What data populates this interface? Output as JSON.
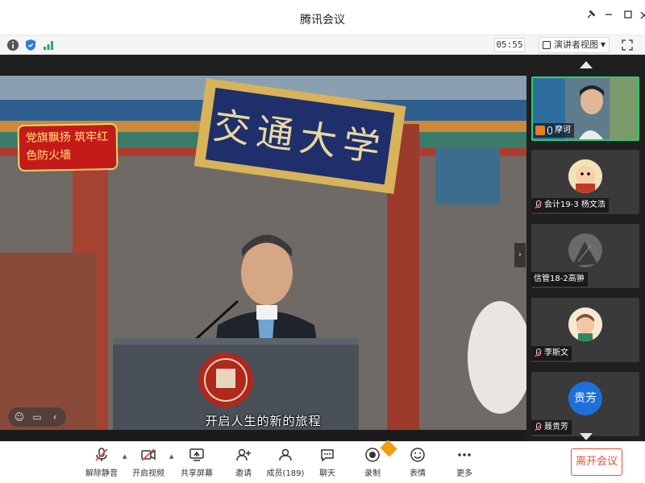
{
  "window": {
    "title": "腾讯会议"
  },
  "infobar": {
    "timer": "05:55",
    "view_mode": "演讲者视图"
  },
  "stage": {
    "caption": "开启人生的新的旅程",
    "banner_text": "党旗飘扬 筑牢红色防火墙",
    "plaque_text": "交通大学"
  },
  "participants": [
    {
      "name": "摩诃",
      "muted": false,
      "active": true
    },
    {
      "name": "会计19-3 杨文浩",
      "muted": true,
      "active": false
    },
    {
      "name": "信管18-2高翀",
      "muted": false,
      "active": false
    },
    {
      "name": "李斯文",
      "muted": true,
      "active": false
    },
    {
      "name": "聂贵芳",
      "avatar_text": "贵芳",
      "muted": true,
      "active": false
    }
  ],
  "toolbar": {
    "mute": "解除静音",
    "video": "开启视频",
    "share": "共享屏幕",
    "invite": "邀请",
    "members": "成员(189)",
    "chat": "聊天",
    "record": "录制",
    "reactions": "表情",
    "more": "更多",
    "leave": "离开会议"
  },
  "colors": {
    "accent_green": "#2ecc71",
    "leave_red": "#e5533a",
    "avatar_blue": "#1e6fd9",
    "banner_red": "#c51a1a"
  }
}
